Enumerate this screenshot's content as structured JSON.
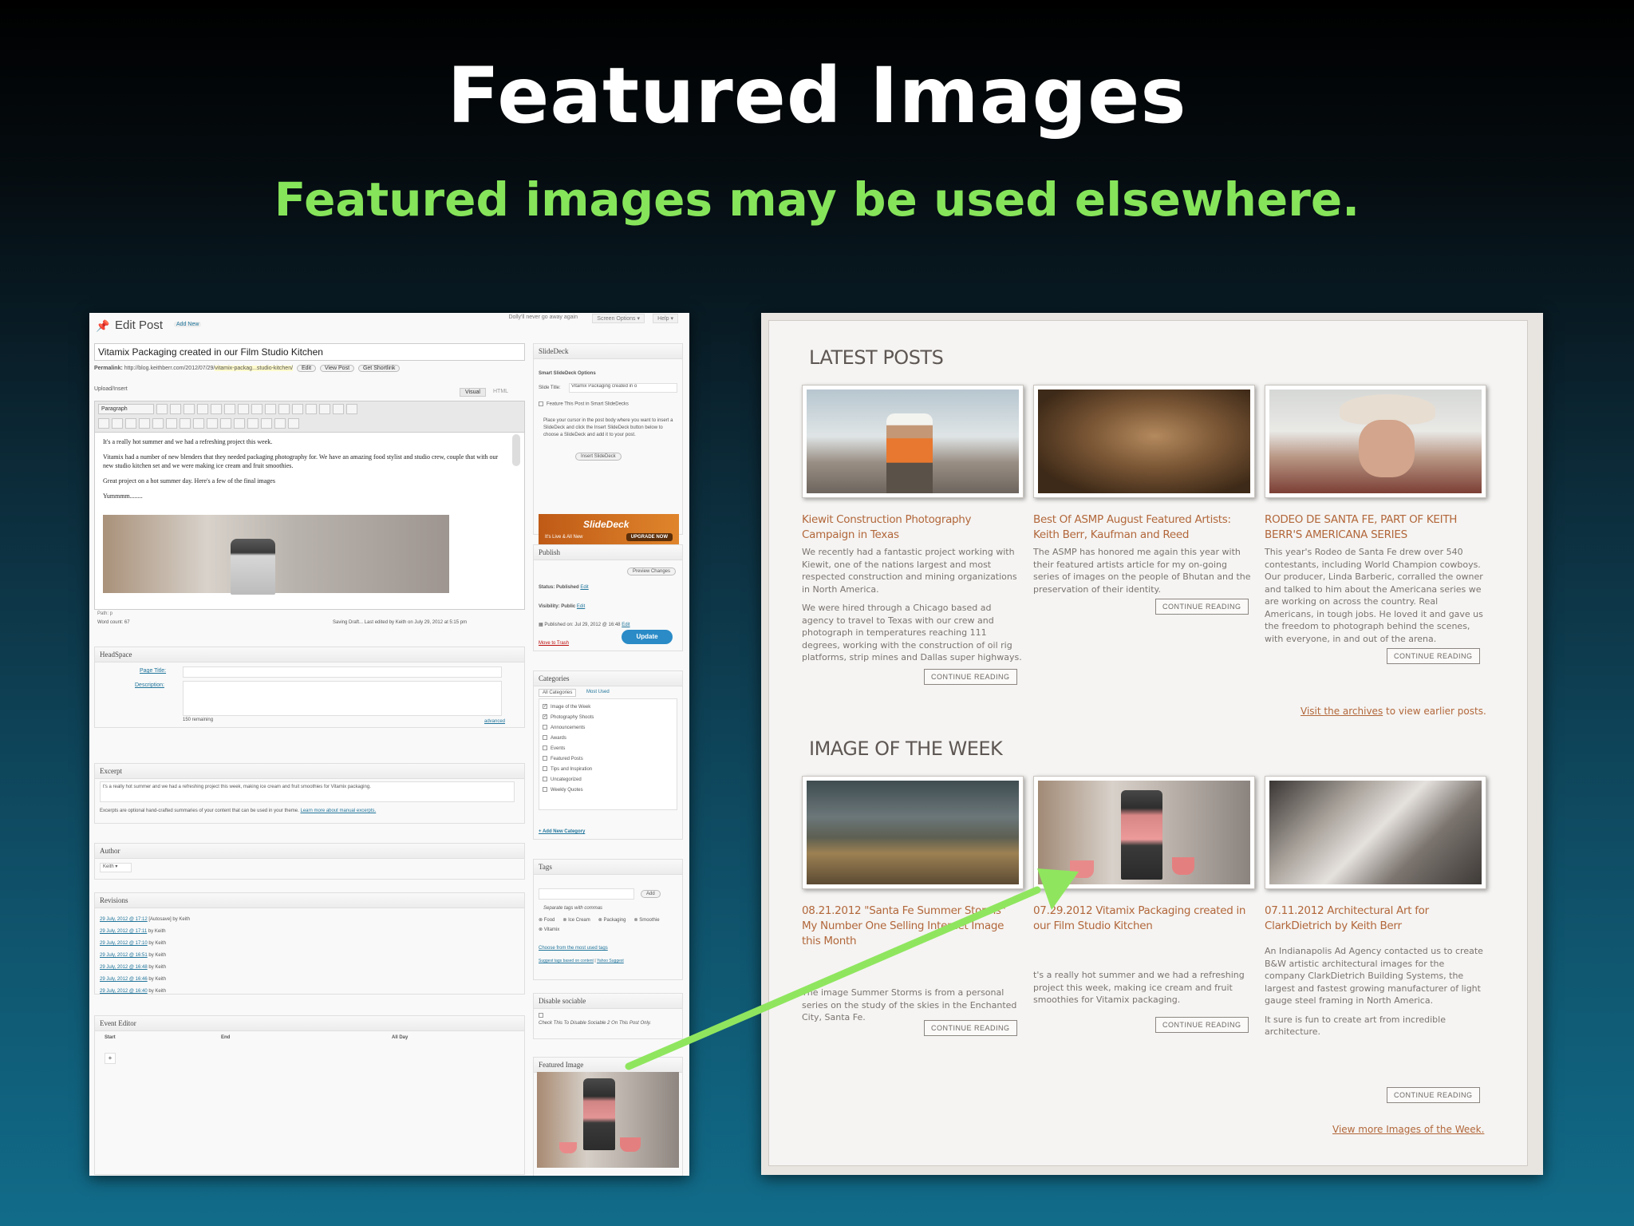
{
  "slide": {
    "title": "Featured Images",
    "subtitle": "Featured images may be used elsewhere."
  },
  "colors": {
    "subtitle_green": "#86e45a",
    "arrow_green": "#8fe65e",
    "wp_link_blue": "#21759b",
    "site_orange": "#b2673b"
  },
  "wp_admin": {
    "top_note": "Dolly'll never go away again",
    "screen_options": "Screen Options ▾",
    "help": "Help ▾",
    "heading": "Edit Post",
    "add_new": "Add New",
    "post_title": "Vitamix Packaging created in our Film Studio Kitchen",
    "permalink_label": "Permalink:",
    "permalink_base": "http://blog.keithberr.com/2012/07/29/",
    "permalink_slug": "vitamix-packag...studio-kitchen/",
    "permalink_buttons": [
      "Edit",
      "View Post",
      "Get Shortlink"
    ],
    "upload_insert": "Upload/Insert",
    "tab_visual": "Visual",
    "tab_html": "HTML",
    "format_select": "Paragraph",
    "editor_paragraphs": [
      "It's a really hot summer and we had a refreshing project this week.",
      "Vitamix had a number of new blenders that they needed packaging photography for. We have an amazing food stylist and studio crew, couple that with our new studio kitchen set and we were making ice cream and fruit smoothies.",
      "Great project on a hot summer day. Here's a few of the final images",
      "Yummmm........"
    ],
    "path": "Path: p",
    "word_count": "Word count: 67",
    "saving_status": "Saving Draft... Last edited by Keith on July 29, 2012 at 5:15 pm",
    "headspace": {
      "heading": "HeadSpace",
      "page_title_label": "Page Title:",
      "description_label": "Description:",
      "remaining": "150 remaining",
      "advanced": "advanced"
    },
    "excerpt": {
      "heading": "Excerpt",
      "text": "t's a really hot summer and we had a refreshing project this week, making ice cream and fruit smoothies for Vitamix packaging.",
      "help": "Excerpts are optional hand-crafted summaries of your content that can be used in your theme.",
      "help_link": "Learn more about manual excerpts."
    },
    "author": {
      "heading": "Author",
      "value": "Keith"
    },
    "revisions": {
      "heading": "Revisions",
      "items": [
        {
          "date": "29 July, 2012 @ 17:12",
          "by": "[Autosave] by Keith"
        },
        {
          "date": "29 July, 2012 @ 17:11",
          "by": "by Keith"
        },
        {
          "date": "29 July, 2012 @ 17:10",
          "by": "by Keith"
        },
        {
          "date": "29 July, 2012 @ 16:51",
          "by": "by Keith"
        },
        {
          "date": "29 July, 2012 @ 16:48",
          "by": "by Keith"
        },
        {
          "date": "29 July, 2012 @ 16:46",
          "by": "by Keith"
        },
        {
          "date": "29 July, 2012 @ 16:40",
          "by": "by Keith"
        }
      ]
    },
    "event_editor": {
      "heading": "Event Editor",
      "columns": [
        "Start",
        "End",
        "All Day"
      ]
    },
    "slidedeck": {
      "heading": "SlideDeck",
      "options_title": "Smart SlideDeck Options",
      "slide_title_label": "Slide Title:",
      "slide_title_value": "Vitamix Packaging created in o",
      "feature_label": "Feature This Post in Smart SlideDecks",
      "instructions": "Place your cursor in the post body where you want to insert a SlideDeck and click the Insert SlideDeck button below to choose a SlideDeck and add it to your post.",
      "insert_button": "Insert SlideDeck",
      "ad_logo": "SlideDeck",
      "ad_tagline": "It's Live & All New",
      "ad_button": "UPGRADE NOW"
    },
    "publish": {
      "heading": "Publish",
      "preview_button": "Preview Changes",
      "status": "Status: Published",
      "visibility": "Visibility: Public",
      "published_on": "Published on: Jul 29, 2012 @ 16:48",
      "edit": "Edit",
      "trash": "Move to Trash",
      "update": "Update"
    },
    "categories": {
      "heading": "Categories",
      "tab_all": "All Categories",
      "tab_most": "Most Used",
      "items": [
        {
          "label": "Image of the Week",
          "checked": "✓"
        },
        {
          "label": "Photography Shoots",
          "checked": "✓"
        },
        {
          "label": "Announcements",
          "checked": ""
        },
        {
          "label": "Awards",
          "checked": ""
        },
        {
          "label": "Events",
          "checked": ""
        },
        {
          "label": "Featured Posts",
          "checked": ""
        },
        {
          "label": "Tips and Inspiration",
          "checked": ""
        },
        {
          "label": "Uncategorized",
          "checked": ""
        },
        {
          "label": "Weekly Quotes",
          "checked": ""
        }
      ],
      "add_new": "+ Add New Category"
    },
    "tags": {
      "heading": "Tags",
      "add_button": "Add",
      "hint": "Separate tags with commas",
      "tag_list": [
        "Food",
        "Ice Cream",
        "Packaging",
        "Smoothie",
        "Vitamix"
      ],
      "choose_link": "Choose from the most used tags",
      "suggest_link": "Suggest tags based on content",
      "yahoo_link": "Yahoo Suggest"
    },
    "sociable": {
      "heading": "Disable sociable",
      "text": "Check This To Disable Sociable 2 On This Post Only."
    },
    "featured_image": {
      "heading": "Featured Image"
    }
  },
  "website": {
    "latest_posts": {
      "heading": "LATEST POSTS",
      "posts": [
        {
          "title": "Kiewit Construction Photography Campaign in Texas",
          "paragraphs": [
            "We recently had a fantastic project working with Kiewit, one of the nations largest and most respected construction and mining organizations in North America.",
            "We were hired through a Chicago based ad agency to travel to Texas with our crew and photograph in temperatures reaching 111 degrees, working with the construction of oil rig platforms, strip mines and Dallas super highways."
          ],
          "continue": "CONTINUE READING"
        },
        {
          "title": "Best Of ASMP August Featured Artists: Keith Berr, Kaufman and Reed",
          "paragraphs": [
            "The ASMP has honored me again this year with their featured artists article for my on-going series of images on the people of Bhutan and the preservation of their identity."
          ],
          "continue": "CONTINUE READING"
        },
        {
          "title": "RODEO DE SANTA FE, PART OF KEITH BERR'S AMERICANA SERIES",
          "paragraphs": [
            "This year's Rodeo de Santa Fe drew over 540 contestants, including World Champion cowboys. Our producer, Linda Barberic, corralled the owner and talked to him about the Americana series we are working on across the country. Real Americans, in tough jobs. He loved it and gave us the freedom to photograph behind the scenes, with everyone, in and out of the arena."
          ],
          "continue": "CONTINUE READING"
        }
      ],
      "archives_link": "Visit the archives",
      "archives_rest": " to view earlier posts."
    },
    "image_of_week": {
      "heading": "IMAGE OF THE WEEK",
      "posts": [
        {
          "title": "08.21.2012 \"Santa Fe Summer Storms\" My Number One Selling Internet Image this Month",
          "paragraphs": [
            "The image Summer Storms is from a personal series on the study of the skies in the Enchanted City, Santa Fe."
          ],
          "continue": "CONTINUE READING"
        },
        {
          "title": "07.29.2012 Vitamix Packaging created in our Film Studio Kitchen",
          "paragraphs": [
            "t's a really hot summer and we had a refreshing project this week, making ice cream and fruit smoothies for Vitamix packaging."
          ],
          "continue": "CONTINUE READING"
        },
        {
          "title": "07.11.2012 Architectural Art for ClarkDietrich by Keith Berr",
          "paragraphs": [
            "An Indianapolis Ad Agency contacted us to create B&W artistic architectural images for the company ClarkDietrich Building Systems, the largest and fastest growing manufacturer of light gauge steel framing in North America.",
            "It sure is fun to create art from incredible architecture."
          ],
          "continue": "CONTINUE READING"
        }
      ],
      "more_link": "View more Images of the Week."
    }
  },
  "icons": [
    "pushpin-icon",
    "arrow-icon",
    "checkbox-icon",
    "resize-handle-icon"
  ]
}
